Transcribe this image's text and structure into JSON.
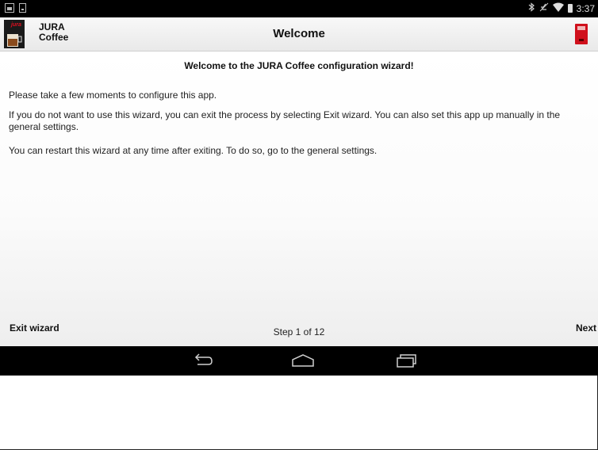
{
  "status_bar": {
    "time": "3:37",
    "icons": [
      "image-notification-icon",
      "phone-notification-icon",
      "bluetooth-icon",
      "mute-icon",
      "wifi-icon",
      "battery-icon"
    ]
  },
  "action_bar": {
    "app_name_line1": "JURA",
    "app_name_line2": "Coffee",
    "title": "Welcome",
    "brand_color": "#d0101c"
  },
  "content": {
    "heading": "Welcome to the JURA Coffee configuration wizard!",
    "paragraphs": [
      "Please take a few moments to configure this app.",
      "If you do not want to use this wizard, you can exit the process by selecting Exit wizard. You can also set this app up manually in the general settings.",
      "You can restart this wizard at any time after exiting. To do so, go to the general settings."
    ]
  },
  "footer": {
    "exit_label": "Exit wizard",
    "step_text": "Step 1 of 12",
    "next_label": "Next"
  },
  "nav_bar": {
    "icons": [
      "back-icon",
      "home-icon",
      "recent-apps-icon"
    ]
  }
}
